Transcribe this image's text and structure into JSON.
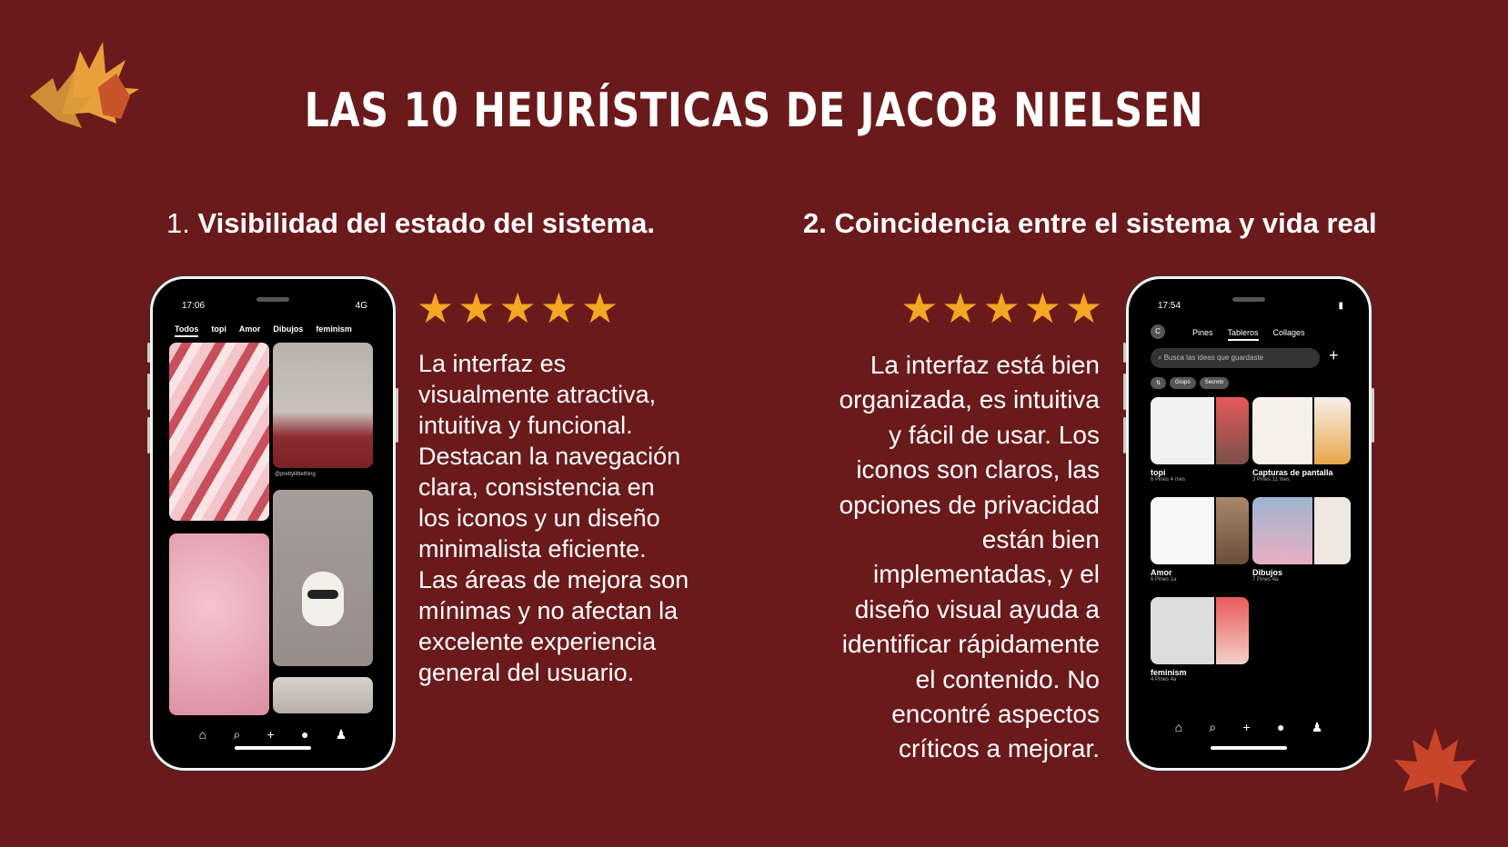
{
  "title": "LAS 10 HEURÍSTICAS DE JACOB NIELSEN",
  "heuristics": [
    {
      "number": "1.",
      "heading": "Visibilidad del estado del sistema.",
      "stars": "★★★★★",
      "text": "La interfaz es visualmente atractiva, intuitiva y funcional. Destacan la navegación clara, consistencia en los iconos y un diseño minimalista eficiente. Las áreas de mejora son mínimas y no afectan la excelente experiencia general del usuario."
    },
    {
      "number": "2.",
      "heading": "Coincidencia entre el sistema y vida real",
      "stars": "★★★★★",
      "text": "La interfaz está bien organizada, es intuitiva y fácil de usar. Los iconos son claros, las opciones de privacidad están bien implementadas, y el diseño visual ayuda a identificar rápidamente el contenido. No encontré aspectos críticos a mejorar."
    }
  ],
  "phone1": {
    "time": "17:06",
    "signal": "4G",
    "tabs": [
      "Todos",
      "topi",
      "Amor",
      "Dibujos",
      "feminism"
    ],
    "pin_author": "@prettylittlething"
  },
  "phone2": {
    "time": "17:54",
    "avatar": "C",
    "tabs": [
      "Pines",
      "Tableros",
      "Collages"
    ],
    "search_placeholder": "Busca las ideas que guardaste",
    "filters": [
      "Grupo",
      "Secreto"
    ],
    "boards": [
      {
        "name": "topi",
        "count": "6 Pines",
        "age": "4 mes"
      },
      {
        "name": "Capturas de pantalla",
        "count": "3 Pines",
        "age": "11 mes"
      },
      {
        "name": "Amor",
        "count": "6 Pines",
        "age": "1a"
      },
      {
        "name": "Dibujos",
        "count": "7 Pines",
        "age": "4a"
      },
      {
        "name": "feminism",
        "count": "4 Pines",
        "age": "4a"
      }
    ]
  },
  "colors": {
    "background": "#6b1a1c",
    "stars": "#f5a623"
  },
  "icons": [
    "maple-leaves-icon",
    "maple-leaf-icon",
    "home-icon",
    "search-icon",
    "plus-icon",
    "chat-icon",
    "profile-icon"
  ]
}
